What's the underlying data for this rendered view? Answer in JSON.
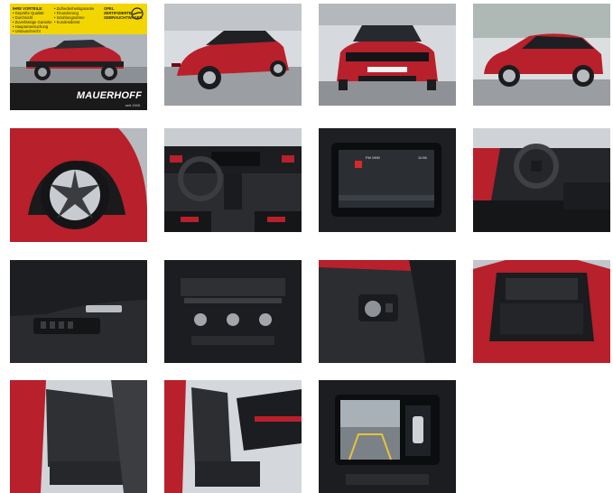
{
  "gallery": {
    "ad": {
      "headline": "IHRE VORTEILE:",
      "benefits_a": [
        "• Geprüfte Qualität",
        "• Durchsicht",
        "• Zuverlässige Garantie",
        "• Hauptuntersuchung",
        "• Umtauschrecht"
      ],
      "benefits_b": [
        "• Zufriedenheitsgarantie",
        "• Finanzierung",
        "• Inzahlungnahme",
        "• Kundendienst"
      ],
      "badge_line1": "OPEL ZERTIFIZIERTE",
      "badge_line2": "GEBRAUCHTWAGEN",
      "dealer_name": "MAUERHOFF",
      "dealer_sub": "seit 1949"
    },
    "infotainment": {
      "status_left": "FM 1990",
      "status_right": "11:56"
    },
    "colors": {
      "car_red": "#b8202b",
      "yellow": "#f3d600",
      "interior_dark": "#1e1f22",
      "floor_grey": "#8e9195"
    },
    "thumbnails": [
      {
        "name": "thumb-front-quarter-ad"
      },
      {
        "name": "thumb-rear-quarter"
      },
      {
        "name": "thumb-front"
      },
      {
        "name": "thumb-side"
      },
      {
        "name": "thumb-wheel"
      },
      {
        "name": "thumb-dashboard"
      },
      {
        "name": "thumb-infotainment-screen"
      },
      {
        "name": "thumb-steering-wheel"
      },
      {
        "name": "thumb-door-panel"
      },
      {
        "name": "thumb-climate-control"
      },
      {
        "name": "thumb-light-switch"
      },
      {
        "name": "thumb-trunk"
      },
      {
        "name": "thumb-rear-seats"
      },
      {
        "name": "thumb-front-seats"
      },
      {
        "name": "thumb-rear-camera-screen"
      }
    ]
  }
}
